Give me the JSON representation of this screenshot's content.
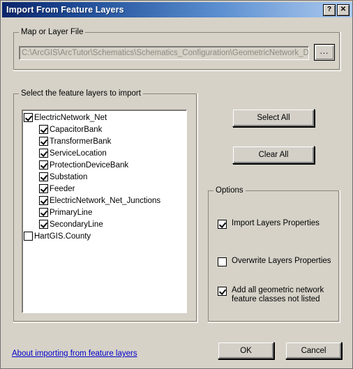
{
  "window": {
    "title": "Import From Feature Layers",
    "help_button": "?",
    "close_button": "✕"
  },
  "map_or_layer_file": {
    "group_label": "Map or Layer File",
    "path_value": "C:\\ArcGIS\\ArcTutor\\Schematics\\Schematics_Configuration\\GeometricNetwork_Data\\W",
    "browse_label": "..."
  },
  "feature_layers": {
    "group_label": "Select the feature layers to import",
    "items": [
      {
        "label": "ElectricNetwork_Net",
        "checked": true,
        "indent": 0
      },
      {
        "label": "CapacitorBank",
        "checked": true,
        "indent": 1
      },
      {
        "label": "TransformerBank",
        "checked": true,
        "indent": 1
      },
      {
        "label": "ServiceLocation",
        "checked": true,
        "indent": 1
      },
      {
        "label": "ProtectionDeviceBank",
        "checked": true,
        "indent": 1
      },
      {
        "label": "Substation",
        "checked": true,
        "indent": 1
      },
      {
        "label": "Feeder",
        "checked": true,
        "indent": 1
      },
      {
        "label": "ElectricNetwork_Net_Junctions",
        "checked": true,
        "indent": 1
      },
      {
        "label": "PrimaryLine",
        "checked": true,
        "indent": 1
      },
      {
        "label": "SecondaryLine",
        "checked": true,
        "indent": 1
      },
      {
        "label": "HartGIS.County",
        "checked": false,
        "indent": 0
      }
    ]
  },
  "selection_buttons": {
    "select_all": "Select All",
    "clear_all": "Clear All"
  },
  "options": {
    "group_label": "Options",
    "items": [
      {
        "label": "Import Layers Properties",
        "checked": true
      },
      {
        "label": "Overwrite Layers Properties",
        "checked": false
      },
      {
        "label": "Add all geometric network\nfeature classes not listed",
        "checked": true
      }
    ]
  },
  "footer": {
    "link_text": "About importing from feature layers",
    "ok": "OK",
    "cancel": "Cancel"
  },
  "colors": {
    "dialog_background": "#d6d2c8",
    "titlebar_start": "#0a246a",
    "titlebar_end": "#a9c9ef",
    "link": "#0000cc",
    "disabled_text": "#8d8a82"
  }
}
